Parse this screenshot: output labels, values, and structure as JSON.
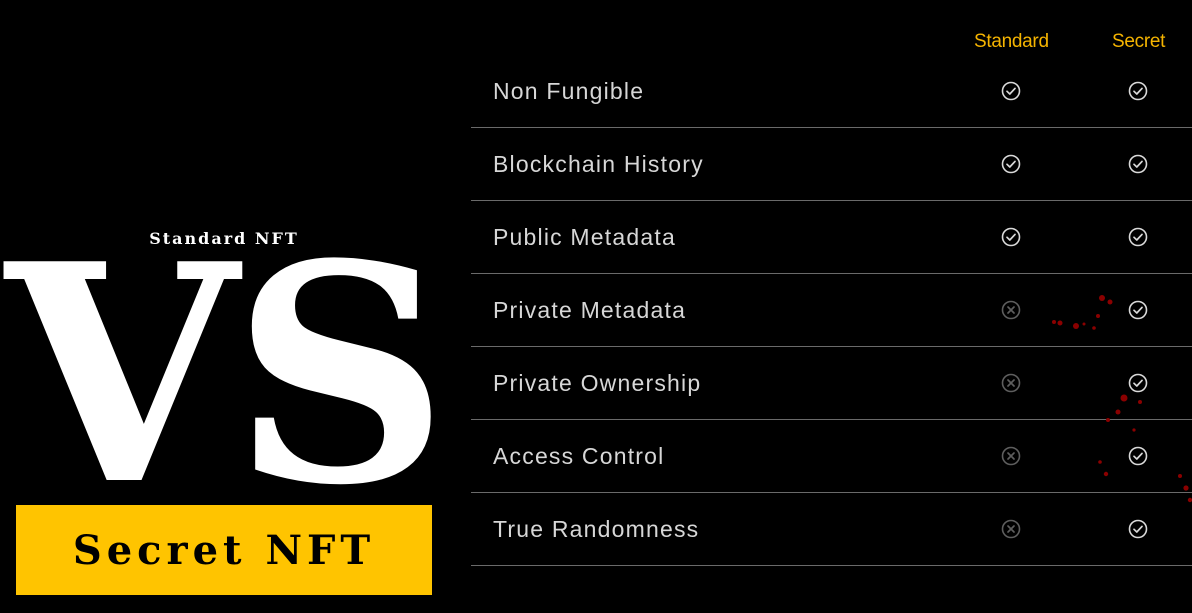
{
  "hero": {
    "subtitle": "Standard NFT",
    "vs": "VS",
    "banner": "Secret NFT"
  },
  "columns": {
    "standard": "Standard",
    "secret": "Secret"
  },
  "colors": {
    "accent": "#f5b400",
    "banner": "#ffc400",
    "check": "#d9d9d9",
    "cross": "#5e5e5e",
    "splatter": "#8b0000"
  },
  "rows": [
    {
      "label": "Non Fungible",
      "standard": "check-icon",
      "secret": "check-icon"
    },
    {
      "label": "Blockchain History",
      "standard": "check-icon",
      "secret": "check-icon"
    },
    {
      "label": "Public Metadata",
      "standard": "check-icon",
      "secret": "check-icon"
    },
    {
      "label": "Private Metadata",
      "standard": "cross-icon",
      "secret": "check-icon"
    },
    {
      "label": "Private Ownership",
      "standard": "cross-icon",
      "secret": "check-icon"
    },
    {
      "label": "Access Control",
      "standard": "cross-icon",
      "secret": "check-icon"
    },
    {
      "label": "True Randomness",
      "standard": "cross-icon",
      "secret": "check-icon"
    }
  ]
}
